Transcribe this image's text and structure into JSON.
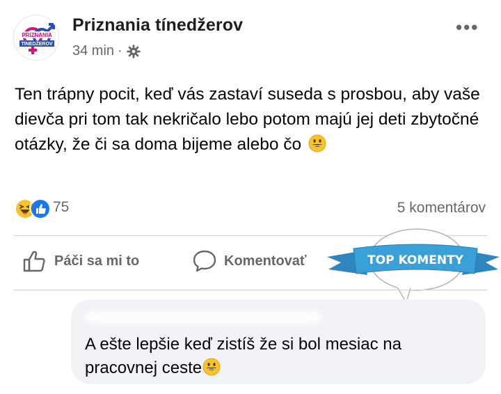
{
  "post": {
    "page_name": "Priznania tínedžerov",
    "avatar_text_top": "PRIZNANIA",
    "avatar_text_bottom": "TÍNEDŽEROV",
    "time": "34 min",
    "separator": "·",
    "privacy_icon": "gear-icon",
    "more_icon": "more-horizontal-icon",
    "more_label": "•••",
    "text": "Ten trápny pocit, keď vás zastaví suseda s prosbou, aby vaše dievča pri tom tak nekričalo lebo potom majú jej deti zbytočné otázky, že či sa doma bijeme alebo čo",
    "text_emoji": "grinning-face-emoji"
  },
  "reactions": {
    "icons": [
      "laughing-reaction-icon",
      "like-reaction-icon"
    ],
    "count": "75",
    "comments": "5 komentárov"
  },
  "actions": {
    "like_label": "Páči sa mi to",
    "comment_label": "Komentovať"
  },
  "banner": {
    "label": "TOP KOMENTY",
    "color": "#3aa0d8"
  },
  "comment": {
    "text": "A ešte lepšie keď zistíš že si bol mesiac na pracovnej ceste",
    "emoji": "grinning-face-emoji"
  },
  "colors": {
    "text": "#050505",
    "muted": "#65676b",
    "like_blue": "#1877f2",
    "bubble_bg": "#f0f2f5",
    "avatar_pink": "#d6117a",
    "avatar_blue": "#2b4fb0"
  }
}
